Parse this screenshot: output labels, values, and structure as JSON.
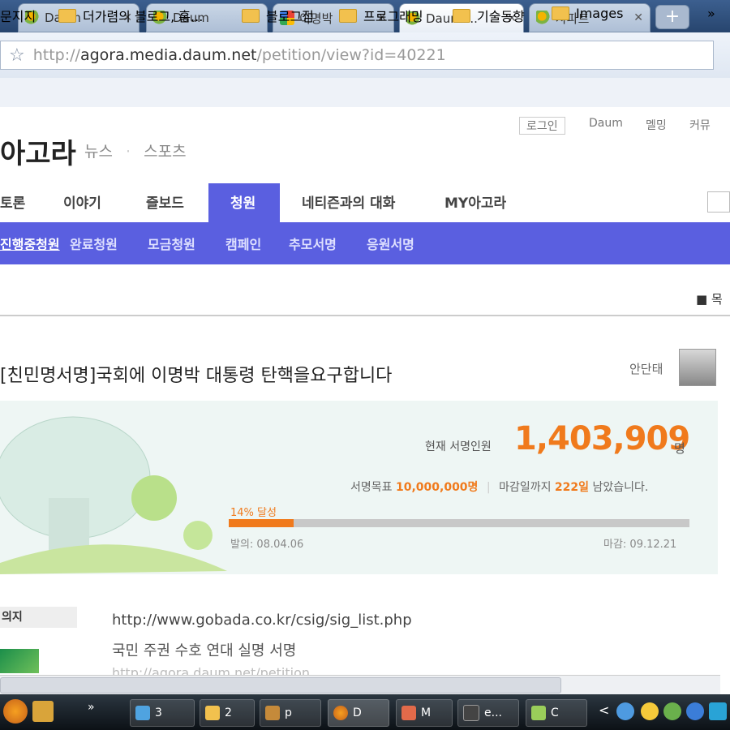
{
  "browser": {
    "tabs": [
      {
        "title": "Daum",
        "icon": "daum-favicon",
        "active": false
      },
      {
        "title": "Daum",
        "icon": "daum-favicon",
        "active": false
      },
      {
        "title": "이명박",
        "icon": "google-favicon",
        "active": false
      },
      {
        "title": "Daum ...",
        "icon": "daum-favicon",
        "active": true
      },
      {
        "title": "사파트",
        "icon": "daum-favicon",
        "active": false
      }
    ],
    "new_tab": "+",
    "url": {
      "scheme": "http://",
      "host": "agora.media.daum.net",
      "path": "/petition/view?id=40221"
    },
    "bookmarks": [
      "문지지",
      "더가렴의 블로그, 홈...",
      "블로그점",
      "프로그래밍",
      "기술동향",
      "Images"
    ],
    "bookmarks_more": "»"
  },
  "site": {
    "logo": "아고라",
    "top_links": {
      "login": "로그인",
      "daum": "Daum",
      "help": "멜밍",
      "home": "커뮤"
    },
    "top_nav": [
      "뉴스",
      "스포츠"
    ],
    "main_nav": [
      "토론",
      "이야기",
      "즐보드",
      "청원",
      "네티즌과의 대화",
      "MY아고라"
    ],
    "active_main": "청원",
    "sub_nav": [
      "진행중청원",
      "완료청원",
      "모금청원",
      "캠페인",
      "추모서명",
      "응원서명"
    ],
    "list_button": "■ 목"
  },
  "petition": {
    "title": "[친민명서명]국회에 이명박 대통령 탄핵을요구합니다",
    "author": "안단태",
    "current_label": "현재 서명인원",
    "current_count": "1,403,909",
    "count_unit": "명",
    "goal_label": "서명목표",
    "goal_value": "10,000,000명",
    "deadline_text": "마감일까지",
    "days_left": "222일",
    "remain_text": "남았습니다.",
    "progress_label": "14% 달성",
    "progress_fraction": 0.14,
    "start_date": "발의: 08.04.06",
    "end_date": "마감: 09.12.21",
    "side_label": "의지",
    "body_lines": [
      "http://www.gobada.co.kr/csig/sig_list.php",
      "국민 주권 수호 연대 실명 서명",
      "http://agora.daum.net/petition"
    ]
  },
  "taskbar": {
    "items": [
      {
        "label": "3",
        "icon": "ie-icon"
      },
      {
        "label": "2",
        "icon": "folder-icon"
      },
      {
        "label": "p",
        "icon": "app-icon"
      },
      {
        "label": "D",
        "icon": "chrome-icon"
      },
      {
        "label": "M",
        "icon": "app-icon"
      },
      {
        "label": "e...",
        "icon": "app-icon"
      },
      {
        "label": "C",
        "icon": "app-icon"
      }
    ],
    "tray_arrow": "<"
  },
  "colors": {
    "accent": "#5a5fe0",
    "count_orange": "#f07a1c",
    "panel_bg": "#eef6f4"
  }
}
